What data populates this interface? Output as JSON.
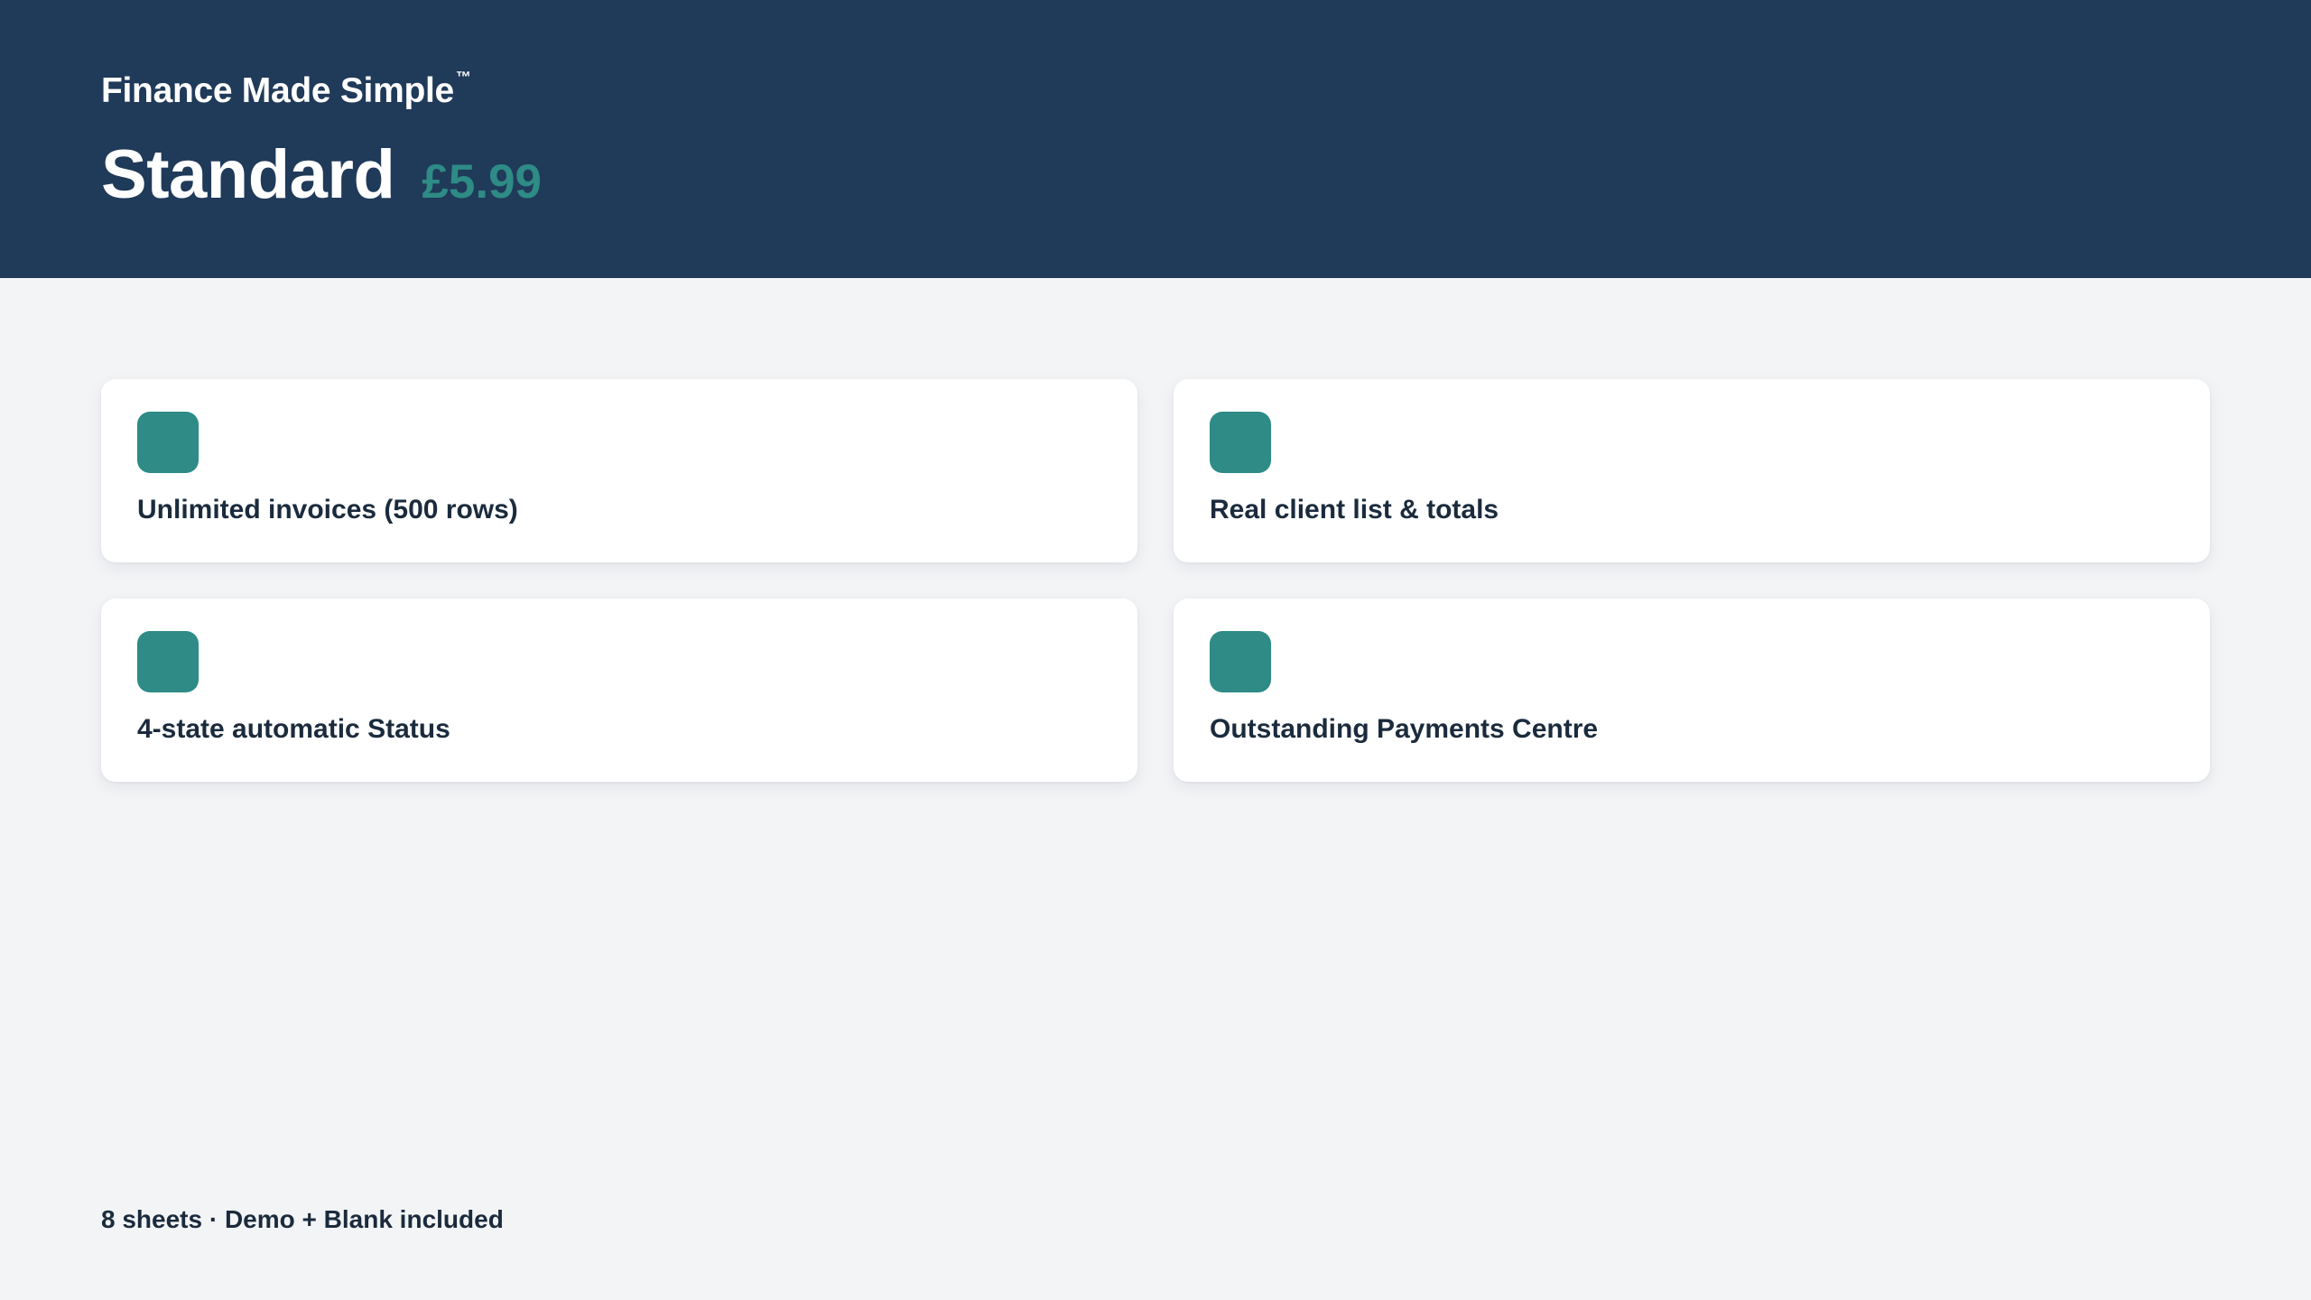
{
  "header": {
    "brand": "Finance Made Simple",
    "brand_mark": "™",
    "plan_name": "Standard",
    "plan_price": "£5.99"
  },
  "features": [
    {
      "label": "Unlimited invoices (500 rows)",
      "icon": "feature-icon"
    },
    {
      "label": "Real client list & totals",
      "icon": "feature-icon"
    },
    {
      "label": "4-state automatic Status",
      "icon": "feature-icon"
    },
    {
      "label": "Outstanding Payments Centre",
      "icon": "feature-icon"
    }
  ],
  "footer": {
    "text": "8 sheets · Demo + Blank included"
  },
  "colors": {
    "header_bg": "#203a59",
    "accent": "#2e8b86",
    "page_bg": "#f3f4f6",
    "text": "#1b2b3d"
  }
}
